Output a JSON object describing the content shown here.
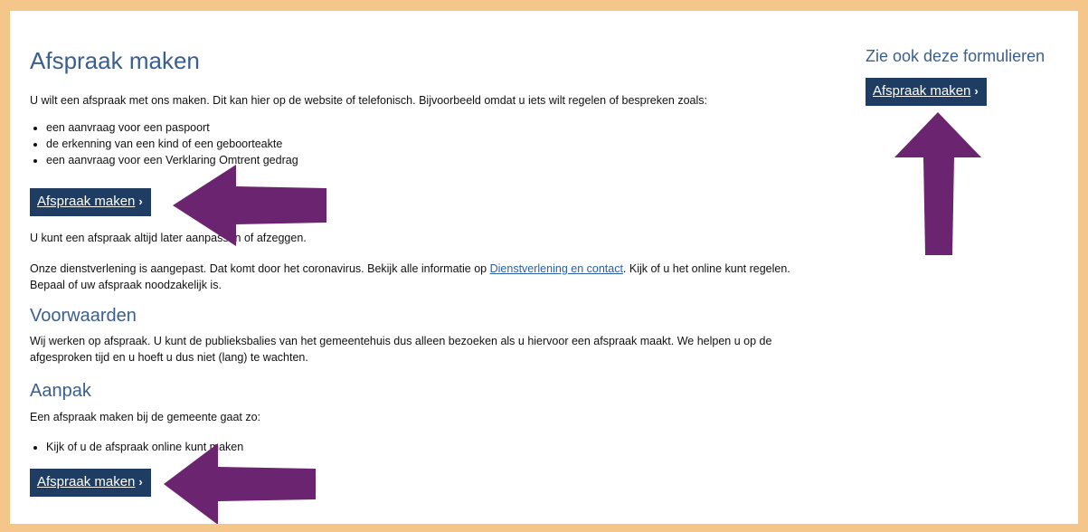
{
  "main": {
    "title": "Afspraak maken",
    "intro": "U wilt een afspraak met ons maken. Dit kan hier op de website of telefonisch. Bijvoorbeeld omdat u iets wilt regelen of bespreken zoals:",
    "examples": [
      "een aanvraag voor een paspoort",
      "de erkenning van een kind of een geboorteakte",
      "een aanvraag voor een Verklaring Omtrent gedrag"
    ],
    "button_label": "Afspraak maken",
    "change_note": "U kunt een afspraak altijd later aanpassen of afzeggen.",
    "service_text_before": "Onze dienstverlening is aangepast. Dat komt door het coronavirus. Bekijk alle informatie op ",
    "service_link": "Dienstverlening en contact",
    "service_text_after": ". Kijk of u het online kunt regelen. Bepaal of uw afspraak noodzakelijk is.",
    "conditions_heading": "Voorwaarden",
    "conditions_text": "Wij werken op afspraak. U kunt de publieksbalies van het gemeentehuis dus alleen bezoeken als u hiervoor een afspraak maakt. We helpen u op de afgesproken tijd en u hoeft u dus niet (lang) te wachten.",
    "approach_heading": "Aanpak",
    "approach_text": "Een afspraak maken bij de gemeente gaat zo:",
    "approach_steps": [
      "Kijk of u de afspraak online kunt maken"
    ],
    "button_label_2": "Afspraak maken"
  },
  "aside": {
    "title": "Zie ook deze formulieren",
    "button_label": "Afspraak maken"
  },
  "colors": {
    "frame": "#f5c68a",
    "button": "#1f3d63",
    "heading": "#3a5f8f",
    "arrow": "#6b246f"
  },
  "icons": {
    "chevron": "chevron-right-icon",
    "annotation": "arrow-annotation"
  }
}
